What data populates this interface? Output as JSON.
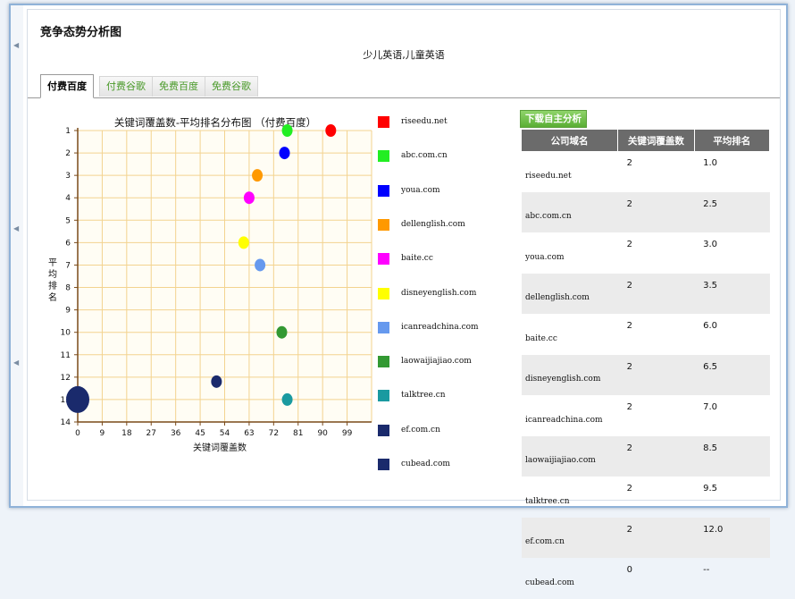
{
  "page": {
    "title": "竞争态势分析图",
    "keyword": "少儿英语,儿童英语"
  },
  "tabs": [
    {
      "label": "付费百度",
      "active": true
    },
    {
      "label": "付费谷歌",
      "active": false
    },
    {
      "label": "免费百度",
      "active": false
    },
    {
      "label": "免费谷歌",
      "active": false
    }
  ],
  "download_button": "下载自主分析",
  "table": {
    "headers": [
      "公司域名",
      "关键词覆盖数",
      "平均排名"
    ],
    "rows": [
      [
        "riseedu.net",
        "2",
        "1.0"
      ],
      [
        "abc.com.cn",
        "2",
        "2.5"
      ],
      [
        "youa.com",
        "2",
        "3.0"
      ],
      [
        "dellenglish.com",
        "2",
        "3.5"
      ],
      [
        "baite.cc",
        "2",
        "6.0"
      ],
      [
        "disneyenglish.com",
        "2",
        "6.5"
      ],
      [
        "icanreadchina.com",
        "2",
        "7.0"
      ],
      [
        "laowaijiajiao.com",
        "2",
        "8.5"
      ],
      [
        "talktree.cn",
        "2",
        "9.5"
      ],
      [
        "ef.com.cn",
        "2",
        "12.0"
      ],
      [
        "cubead.com",
        "0",
        "--"
      ]
    ]
  },
  "chart_data": {
    "type": "scatter",
    "title": "关键词覆盖数-平均排名分布图 （付费百度）",
    "xlabel": "关键词覆盖数",
    "ylabel": "平均排名",
    "xlim": [
      0,
      108
    ],
    "ylim": [
      1,
      14
    ],
    "y_inverted": true,
    "xticks": [
      "0",
      "9",
      "18",
      "27",
      "36",
      "45",
      "54",
      "63",
      "72",
      "81",
      "90",
      "99"
    ],
    "yticks": [
      "1",
      "2",
      "3",
      "4",
      "5",
      "6",
      "7",
      "8",
      "9",
      "10",
      "11",
      "12",
      "13",
      "14"
    ],
    "grid": true,
    "legend_position": "right",
    "series": [
      {
        "name": "riseedu.net",
        "color": "#ff0000",
        "x": 93,
        "y": 1.0
      },
      {
        "name": "abc.com.cn",
        "color": "#22ee22",
        "x": 77,
        "y": 1.0
      },
      {
        "name": "youa.com",
        "color": "#0000ff",
        "x": 76,
        "y": 2.0
      },
      {
        "name": "dellenglish.com",
        "color": "#ff9900",
        "x": 66,
        "y": 3.0
      },
      {
        "name": "baite.cc",
        "color": "#ff00ff",
        "x": 63,
        "y": 4.0
      },
      {
        "name": "disneyenglish.com",
        "color": "#ffff00",
        "x": 61,
        "y": 6.0
      },
      {
        "name": "icanreadchina.com",
        "color": "#6699ee",
        "x": 67,
        "y": 7.0
      },
      {
        "name": "laowaijiajiao.com",
        "color": "#339933",
        "x": 75,
        "y": 10.0
      },
      {
        "name": "talktree.cn",
        "color": "#1a9aa0",
        "x": 77,
        "y": 13.0
      },
      {
        "name": "ef.com.cn",
        "color": "#1a2a6c",
        "x": 51,
        "y": 12.2
      },
      {
        "name": "cubead.com",
        "color": "#1a2a6c",
        "x": 0,
        "y": 13.0,
        "large": true
      }
    ]
  }
}
